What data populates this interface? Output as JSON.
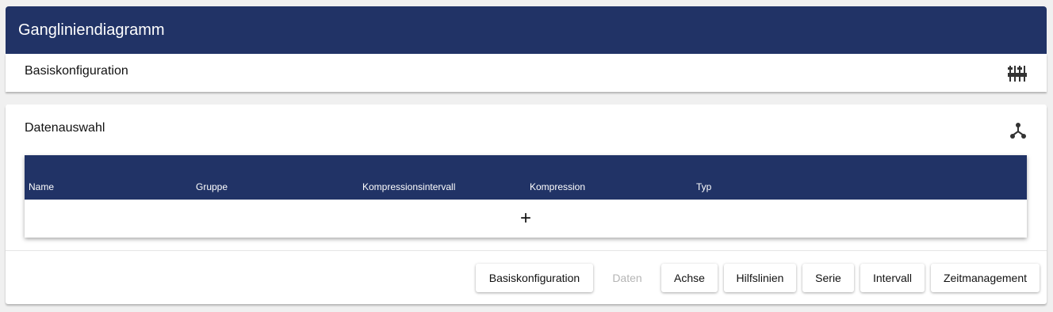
{
  "header": {
    "title": "Gangliniendiagramm"
  },
  "basis_section": {
    "title": "Basiskonfiguration",
    "icon": "sliders-icon"
  },
  "data_section": {
    "title": "Datenauswahl",
    "icon": "hub-icon",
    "table": {
      "columns": [
        "Name",
        "Gruppe",
        "Kompressionsintervall",
        "Kompression",
        "Typ"
      ],
      "rows": [],
      "add_label": "+"
    }
  },
  "footer_buttons": [
    {
      "label": "Basiskonfiguration",
      "disabled": false
    },
    {
      "label": "Daten",
      "disabled": true
    },
    {
      "label": "Achse",
      "disabled": false
    },
    {
      "label": "Hilfslinien",
      "disabled": false
    },
    {
      "label": "Serie",
      "disabled": false
    },
    {
      "label": "Intervall",
      "disabled": false
    },
    {
      "label": "Zeitmanagement",
      "disabled": false
    }
  ],
  "colors": {
    "primary": "#213366",
    "background": "#f0f0f0",
    "disabled_text": "#b5b5b5"
  }
}
